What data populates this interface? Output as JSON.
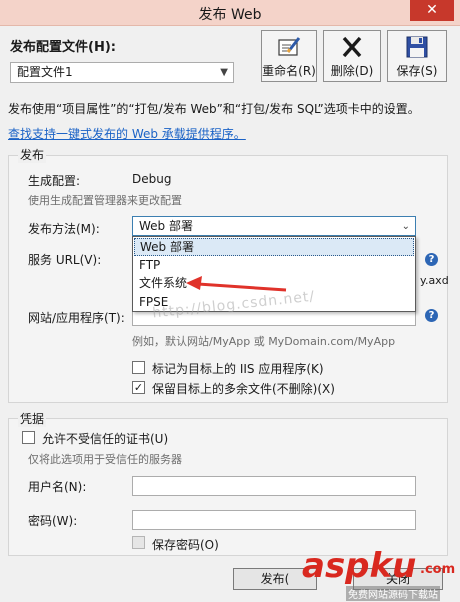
{
  "window": {
    "title": "发布 Web",
    "close_glyph": "✕"
  },
  "profile": {
    "label": "发布配置文件(H):",
    "selected": "配置文件1"
  },
  "toolbar": {
    "rename_label": "重命名(R)",
    "delete_label": "删除(D)",
    "save_label": "保存(S)"
  },
  "info": {
    "text": "发布使用“项目属性”的“打包/发布 Web”和“打包/发布 SQL”选项卡中的设置。",
    "link": "查找支持一键式发布的 Web 承载提供程序。"
  },
  "publish": {
    "group_title": "发布",
    "build_config_label": "生成配置:",
    "build_config_value": "Debug",
    "build_config_hint": "使用生成配置管理器来更改配置",
    "method_label": "发布方法(M):",
    "method_value": "Web 部署",
    "method_options": [
      "Web 部署",
      "FTP",
      "文件系统",
      "FPSE"
    ],
    "service_url_label": "服务 URL(V):",
    "service_url_suffix": "y.axd",
    "site_label": "网站/应用程序(T):",
    "site_example": "例如，默认网站/MyApp 或 MyDomain.com/MyApp",
    "iis_app_label": "标记为目标上的 IIS 应用程序(K)",
    "iis_app_checked": false,
    "keep_files_label": "保留目标上的多余文件(不删除)(X)",
    "keep_files_checked": true,
    "help_glyph": "?"
  },
  "credentials": {
    "group_title": "凭据",
    "untrusted_label": "允许不受信任的证书(U)",
    "untrusted_checked": false,
    "untrusted_hint": "仅将此选项用于受信任的服务器",
    "username_label": "用户名(N):",
    "username_value": "",
    "password_label": "密码(W):",
    "password_value": "",
    "save_password_label": "保存密码(O)",
    "save_password_checked": false
  },
  "footer": {
    "publish_label": "发布(",
    "close_label": "关闭"
  },
  "watermark": {
    "blog_text": "http://blog.csdn.net/",
    "brand_text": "aspku",
    "brand_tld": ".com",
    "brand_sub": "免费网站源码下载站"
  },
  "colors": {
    "accent": "#1a62c6",
    "close_red": "#c7382b",
    "arrow_red": "#e0322a",
    "brand_red": "#d9281f"
  }
}
